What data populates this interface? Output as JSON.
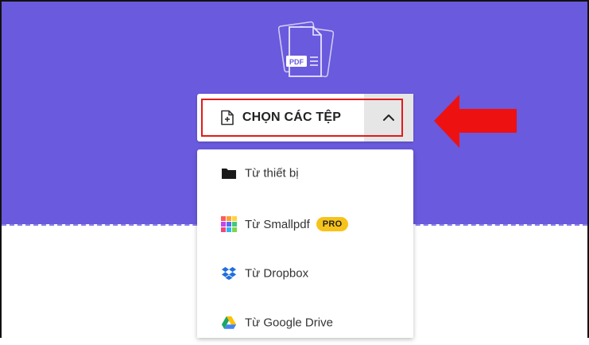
{
  "upload": {
    "pdf_graphic_text": "PDF",
    "choose_files_label": "CHỌN CÁC TỆP",
    "toggle_icon": "chevron-up-icon",
    "accent_color": "#6a5add",
    "highlight_color": "#e21a1a"
  },
  "menu": {
    "items": [
      {
        "label": "Từ thiết bị",
        "icon": "folder-icon"
      },
      {
        "label": "Từ Smallpdf",
        "icon": "smallpdf-icon",
        "badge": "PRO"
      },
      {
        "label": "Từ Dropbox",
        "icon": "dropbox-icon"
      },
      {
        "label": "Từ Google Drive",
        "icon": "google-drive-icon"
      }
    ]
  }
}
